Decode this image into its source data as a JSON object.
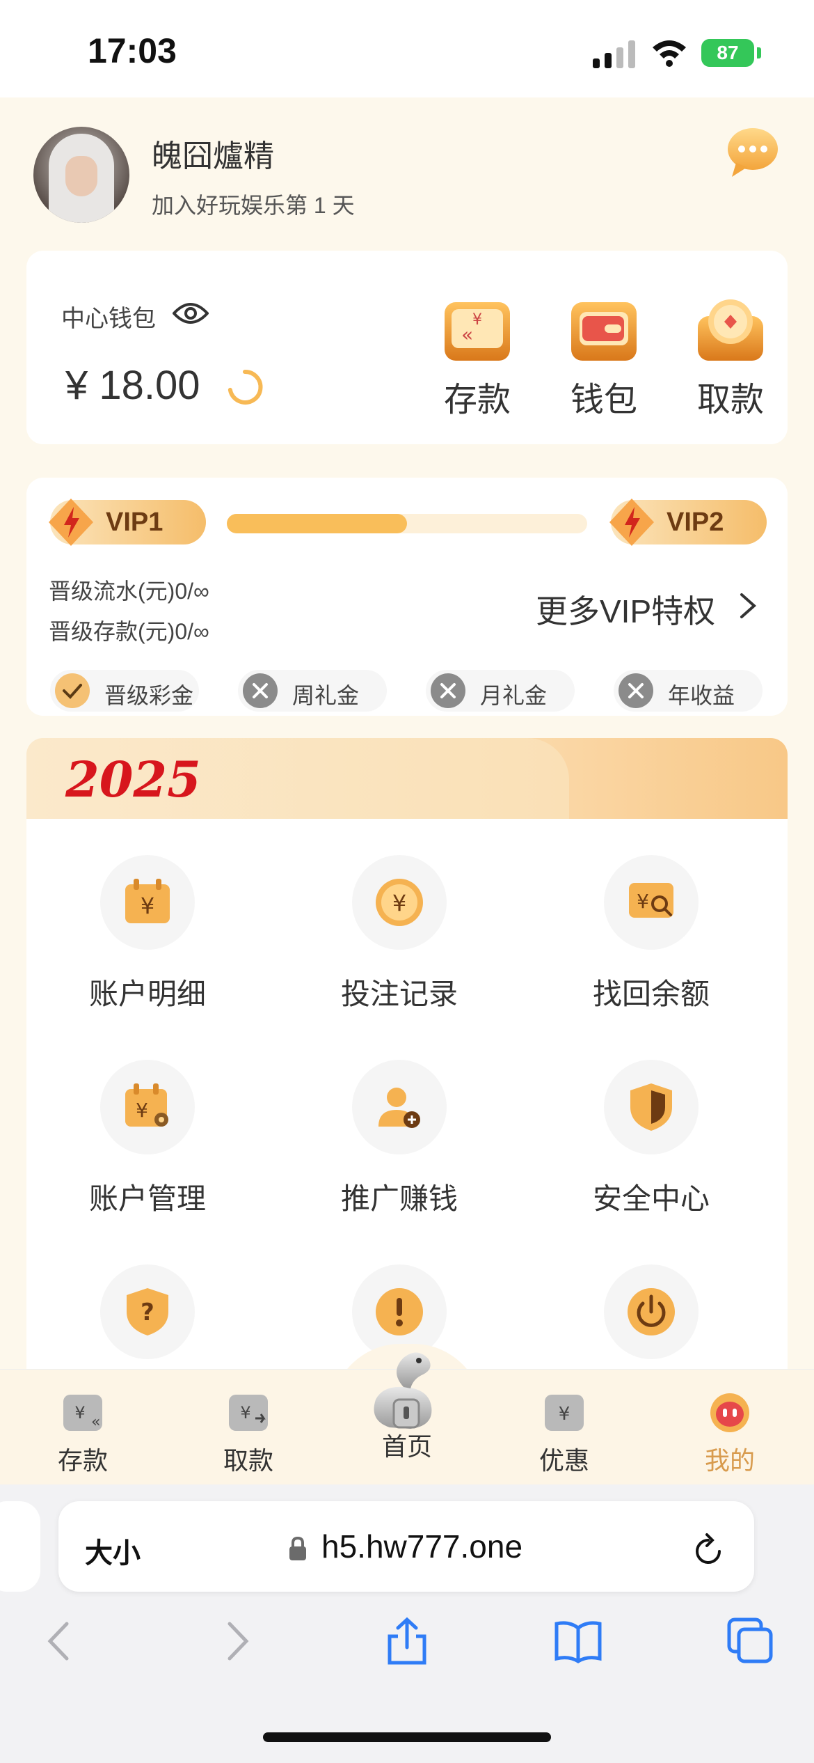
{
  "status_bar": {
    "time": "17:03",
    "battery": "87"
  },
  "profile": {
    "username": "魄囧爐精",
    "joined": "加入好玩娱乐第 1 天"
  },
  "wallet": {
    "label": "中心钱包",
    "balance": "¥ 18.00",
    "actions": [
      {
        "label": "存款",
        "icon": "deposit-icon"
      },
      {
        "label": "钱包",
        "icon": "wallet-icon"
      },
      {
        "label": "取款",
        "icon": "withdraw-icon"
      }
    ]
  },
  "vip": {
    "current": "VIP1",
    "next": "VIP2",
    "progress_fraction": 0.5,
    "turnover_req": "晋级流水(元)0/∞",
    "deposit_req": "晋级存款(元)0/∞",
    "more_link": "更多VIP特权",
    "perks": [
      {
        "label": "晋级彩金",
        "status": "checked"
      },
      {
        "label": "周礼金",
        "status": "unavailable"
      },
      {
        "label": "月礼金",
        "status": "unavailable"
      },
      {
        "label": "年收益",
        "status": "unavailable"
      }
    ]
  },
  "banner": {
    "text": "2025"
  },
  "menu": {
    "items": [
      {
        "label": "账户明细",
        "icon": "account-details-icon"
      },
      {
        "label": "投注记录",
        "icon": "bet-record-icon"
      },
      {
        "label": "找回余额",
        "icon": "recover-balance-icon"
      },
      {
        "label": "账户管理",
        "icon": "account-manage-icon"
      },
      {
        "label": "推广赚钱",
        "icon": "promote-earn-icon"
      },
      {
        "label": "安全中心",
        "icon": "security-shield-icon"
      },
      {
        "label": "",
        "icon": "help-icon"
      },
      {
        "label": "",
        "icon": "notice-icon"
      },
      {
        "label": "",
        "icon": "logout-power-icon"
      }
    ]
  },
  "tabbar": {
    "items": [
      {
        "label": "存款",
        "icon": "deposit-tab-icon"
      },
      {
        "label": "取款",
        "icon": "withdraw-tab-icon"
      },
      {
        "label": "首页",
        "icon": "home-snake-icon"
      },
      {
        "label": "优惠",
        "icon": "promo-tab-icon"
      },
      {
        "label": "我的",
        "icon": "profile-tab-icon"
      }
    ],
    "active": "我的"
  },
  "browser": {
    "text_size": "大小",
    "url": "h5.hw777.one"
  },
  "colors": {
    "accent": "#f9be5a",
    "active_tab": "#d89b4e",
    "banner_red": "#d7161d"
  }
}
